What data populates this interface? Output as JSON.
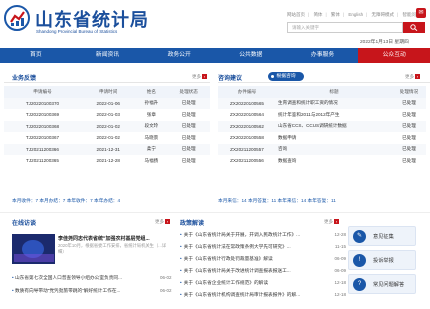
{
  "header": {
    "logo_cn": "山东省统计局",
    "logo_en": "Shandong Provincial Bureau of Statistics",
    "top_links": [
      "网站首页",
      "简体",
      "繁体",
      "English",
      "无障碍模式",
      "智能问答"
    ],
    "search_placeholder": "请输入关键字",
    "date": "2022年1月13日 星期四"
  },
  "nav": [
    "首页",
    "新闻资讯",
    "政务公开",
    "公共数据",
    "办事服务",
    "公众互动"
  ],
  "left": {
    "title": "业务反馈",
    "more": "更多",
    "columns": [
      "申请编号",
      "申请时间",
      "姓名",
      "处理状态"
    ],
    "rows": [
      [
        "TJ20220100370",
        "2022-01-06",
        "孙福升",
        "已处理"
      ],
      [
        "TJ20220100369",
        "2022-01-03",
        "张章",
        "已处理"
      ],
      [
        "TJ20220100368",
        "2022-01-02",
        "段文玲",
        "已处理"
      ],
      [
        "TJ20220100367",
        "2022-01-02",
        "马晓景",
        "已处理"
      ],
      [
        "TJ20211200366",
        "2021-12-31",
        "柔宁",
        "已处理"
      ],
      [
        "TJ20211200365",
        "2021-12-28",
        "马福扬",
        "已处理"
      ]
    ],
    "stats": "本月收件：7  本月办结：7  本年收件：7  本年办结：4"
  },
  "right": {
    "title": "咨询建议",
    "tab_selected": "根据咨询",
    "more": "更多",
    "columns": [
      "办件编号",
      "标题",
      "处理情况"
    ],
    "rows": [
      [
        "ZX20220100565",
        "生育调查和统计职工资的情况",
        "已处理"
      ],
      [
        "ZX20220100564",
        "统计年鉴和2011与2012年产生",
        "已处理"
      ],
      [
        "ZX20220100562",
        "山东省CCS、CCUS调研统计数据",
        "已处理"
      ],
      [
        "ZX20220100558",
        "数据申请",
        "已处理"
      ],
      [
        "ZX20211200557",
        "咨询",
        "已处理"
      ],
      [
        "ZX20211200556",
        "数据查询",
        "已处理"
      ]
    ],
    "stats": "本月来信：14  本月答复：11  本年来信：14  本年答复：11"
  },
  "video": {
    "title": "在线访谈",
    "more": "更多",
    "headline": "李佳尧同志代表省统“加强农村基层党组...",
    "desc": "2020年10月，根据省委工作安排，省统计局机关生（...详细）"
  },
  "left_news": [
    {
      "text": "山东省第七次全国人口普查领导小组办公室负责同...",
      "date": "06-02"
    },
    {
      "text": "数质有向导带动“党凭劲旅带跳的”解好统计工作在...",
      "date": "06-02"
    }
  ],
  "policy": {
    "title": "政策解读",
    "more": "更多",
    "items": [
      {
        "text": "关于《山东省统计局关于开展，开调入民政统计工作》...",
        "date": "12-28"
      },
      {
        "text": "关于《山东省统计法在常政策条例大学先可研究》...",
        "date": "11-15"
      },
      {
        "text": "关于《山东省统计行政处罚裁量基准》解读",
        "date": "06-09"
      },
      {
        "text": "关于《山东省统计局关于改进统计调查报表报送工...",
        "date": "06-09"
      },
      {
        "text": "关于《山东省企业统计工作规范》的解读",
        "date": "12-18"
      },
      {
        "text": "关于《山东省统计机构调查统计局审计报表报件》的解...",
        "date": "12-18"
      }
    ]
  },
  "side_buttons": [
    "意见征集",
    "投诉举报",
    "常见问题解答"
  ],
  "colors": {
    "brand_blue": "#1a57a8",
    "brand_red": "#c7151b"
  }
}
